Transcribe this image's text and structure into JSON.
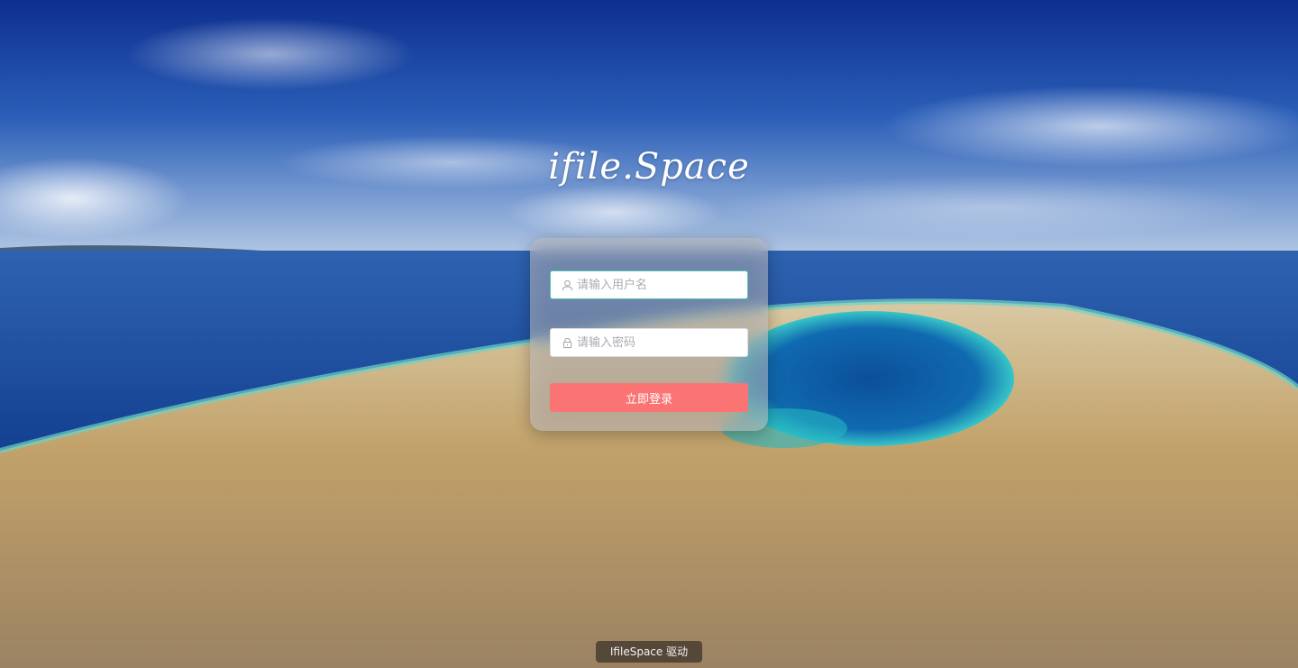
{
  "logo": {
    "text": "ifile.Space"
  },
  "login": {
    "username_placeholder": "请输入用户名",
    "username_value": "",
    "password_placeholder": "请输入密码",
    "password_value": "",
    "submit_label": "立即登录"
  },
  "footer": {
    "powered_by": "IfileSpace 驱动"
  },
  "icons": {
    "username": "user-icon",
    "password": "lock-icon"
  },
  "colors": {
    "accent_button": "#fb7474",
    "focused_border": "#52c7b0"
  }
}
